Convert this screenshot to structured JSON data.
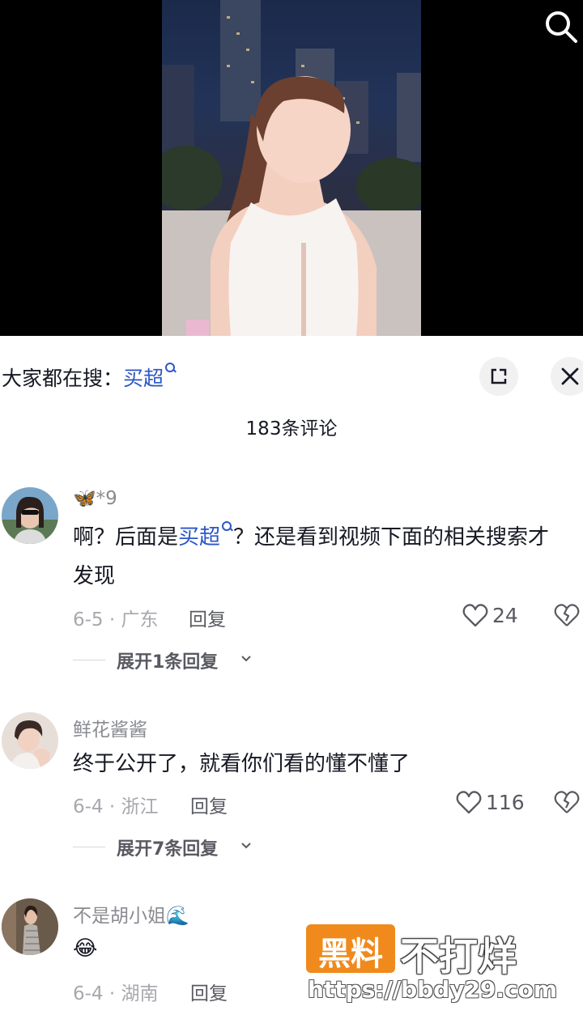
{
  "search_hint": {
    "prefix": "大家都在搜：",
    "term": "买超"
  },
  "comments_count": "183条评论",
  "comments": [
    {
      "username": "🦋*9",
      "text_parts": [
        "啊？后面是",
        "买超",
        "？还是看到视频下面的相关搜索才发现"
      ],
      "date": "6-5 · 广东",
      "reply_label": "回复",
      "likes": "24",
      "expand_label": "展开1条回复"
    },
    {
      "username": "鲜花酱酱",
      "text": "终于公开了，就看你们看的懂不懂了",
      "date": "6-4 · 浙江",
      "reply_label": "回复",
      "likes": "116",
      "expand_label": "展开7条回复"
    },
    {
      "username": "不是胡小姐🌊",
      "text": "😂",
      "date": "6-4 · 湖南",
      "reply_label": "回复"
    }
  ],
  "watermark": {
    "badge": "黑料",
    "title": "不打烊",
    "url": "https://bbdy29.com"
  },
  "icons": {
    "search": "search-icon",
    "expand": "expand-icon",
    "close": "close-icon",
    "like": "heart-icon",
    "dislike": "broken-heart-icon",
    "chevron": "chevron-down-icon"
  },
  "colors": {
    "link": "#2b56c6",
    "watermark_badge": "#f08a1c"
  }
}
